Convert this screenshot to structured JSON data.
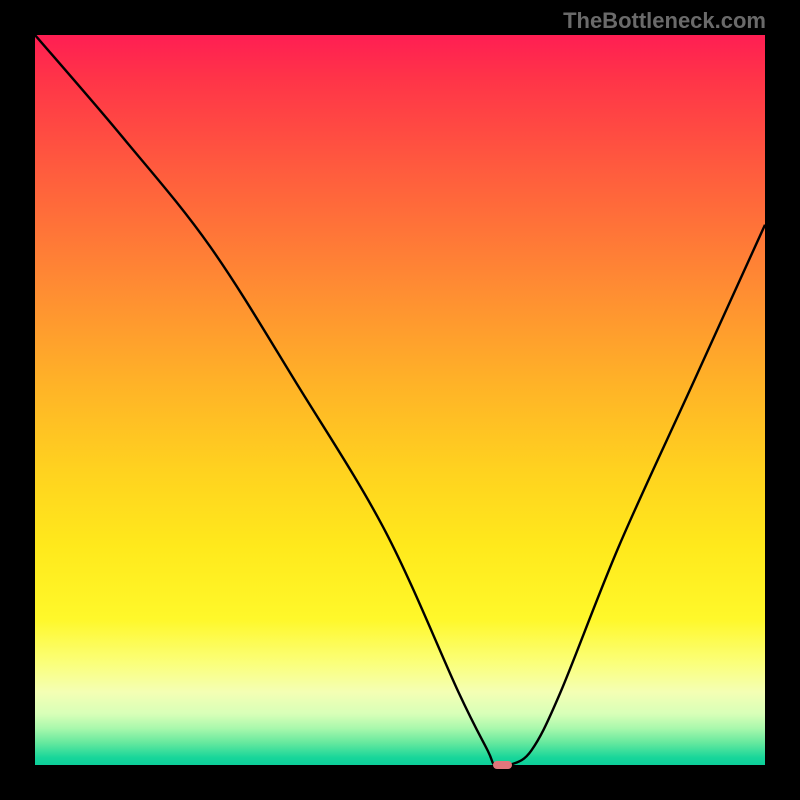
{
  "attribution": "TheBottleneck.com",
  "chart_data": {
    "type": "line",
    "title": "",
    "xlabel": "",
    "ylabel": "",
    "xlim": [
      0,
      100
    ],
    "ylim": [
      0,
      100
    ],
    "x": [
      0,
      12,
      24,
      36,
      48,
      58,
      62,
      63,
      65,
      68,
      72,
      80,
      90,
      100
    ],
    "y": [
      100,
      86,
      71,
      52,
      32,
      10,
      2,
      0,
      0,
      2,
      10,
      30,
      52,
      74
    ],
    "marker": {
      "x": 64,
      "y": 0,
      "width_pct": 2.6,
      "height_pct": 1.2
    },
    "gradient_stops": [
      {
        "pct": 0,
        "color": "#ff1e53"
      },
      {
        "pct": 6,
        "color": "#ff3448"
      },
      {
        "pct": 18,
        "color": "#ff5a3e"
      },
      {
        "pct": 34,
        "color": "#ff8a33"
      },
      {
        "pct": 48,
        "color": "#ffb327"
      },
      {
        "pct": 60,
        "color": "#ffd31f"
      },
      {
        "pct": 70,
        "color": "#ffe91c"
      },
      {
        "pct": 80,
        "color": "#fff82a"
      },
      {
        "pct": 86,
        "color": "#fbff7a"
      },
      {
        "pct": 90,
        "color": "#f4ffb4"
      },
      {
        "pct": 93,
        "color": "#d8ffb8"
      },
      {
        "pct": 95,
        "color": "#a8f8ac"
      },
      {
        "pct": 97,
        "color": "#64e89e"
      },
      {
        "pct": 99,
        "color": "#18d69a"
      },
      {
        "pct": 100,
        "color": "#0ccf9a"
      }
    ]
  }
}
